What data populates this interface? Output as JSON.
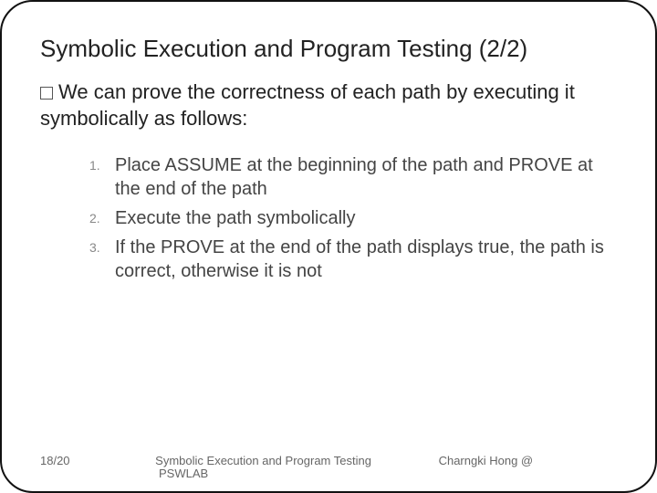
{
  "title": "Symbolic Execution and Program Testing (2/2)",
  "lead": "We can prove the correctness of each path by executing it symbolically as follows:",
  "steps": [
    "Place ASSUME at the beginning of the path and PROVE at the end of the path",
    "Execute the path symbolically",
    "If the PROVE at the end of the path displays true, the path is correct, otherwise it is not"
  ],
  "footer": {
    "page": "18/20",
    "center": "Symbolic Execution and Program Testing",
    "right": "Charngki Hong @",
    "lab": "PSWLAB"
  }
}
